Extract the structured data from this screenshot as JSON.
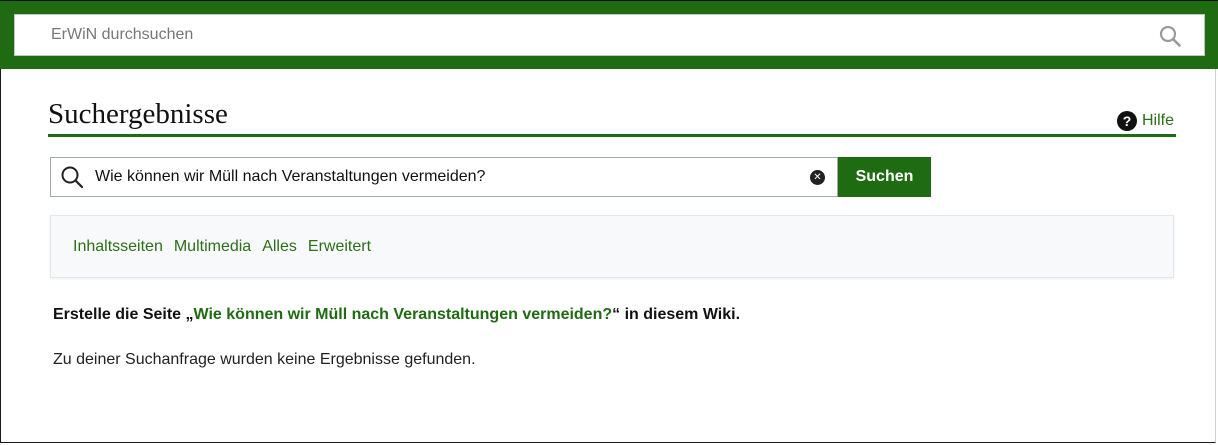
{
  "header": {
    "search_placeholder": "ErWiN durchsuchen",
    "search_icon": "search-icon"
  },
  "page": {
    "title": "Suchergebnisse",
    "help_label": "Hilfe",
    "help_icon": "question-circle-icon"
  },
  "search": {
    "query": "Wie können wir Müll nach Veranstaltungen vermeiden?",
    "clear_icon": "clear-icon",
    "button_label": "Suchen"
  },
  "tabs": [
    {
      "label": "Inhaltsseiten"
    },
    {
      "label": "Multimedia"
    },
    {
      "label": "Alles"
    },
    {
      "label": "Erweitert"
    }
  ],
  "results": {
    "create_prefix": "Erstelle die Seite „",
    "create_link": "Wie können wir Müll nach Veranstaltungen vermeiden?",
    "create_suffix": "“ in diesem Wiki.",
    "no_results": "Zu deiner Suchanfrage wurden keine Ergebnisse gefunden."
  },
  "colors": {
    "accent": "#1e6b12",
    "link": "#2c6e1a"
  }
}
